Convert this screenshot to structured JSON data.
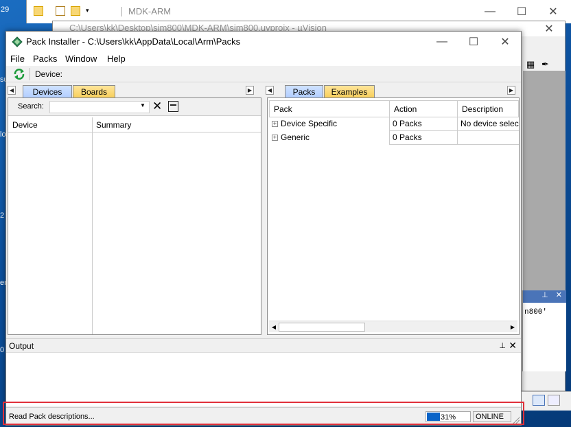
{
  "desktop": {
    "items": [
      "29",
      "su",
      "lo",
      "2",
      "er",
      "0"
    ]
  },
  "explorer": {
    "title": "MDK-ARM"
  },
  "uvision": {
    "title": "C:\\Users\\kk\\Desktop\\sim800\\MDK-ARM\\sim800.uvprojx - µVision",
    "panel_text": "n800'"
  },
  "pack_installer": {
    "title": "Pack Installer - C:\\Users\\kk\\AppData\\Local\\Arm\\Packs",
    "menu": [
      "File",
      "Packs",
      "Window",
      "Help"
    ],
    "toolbar": {
      "device_label": "Device:"
    },
    "left_tabs": [
      "Devices",
      "Boards"
    ],
    "left_active_tab": "Devices",
    "search": {
      "label": "Search:",
      "value": ""
    },
    "left_columns": [
      "Device",
      "Summary"
    ],
    "right_tabs": [
      "Packs",
      "Examples"
    ],
    "right_active_tab": "Packs",
    "right_columns": [
      "Pack",
      "Action",
      "Description"
    ],
    "pack_rows": [
      {
        "pack": "Device Specific",
        "action": "0 Packs",
        "description": "No device selected"
      },
      {
        "pack": "Generic",
        "action": "0 Packs",
        "description": ""
      }
    ],
    "output": {
      "title": "Output"
    },
    "status": {
      "message": "Read Pack descriptions...",
      "progress_percent": 31,
      "progress_label": "31%",
      "connection": "ONLINE"
    }
  },
  "colors": {
    "active_tab": "#b2ceff",
    "inactive_tab": "#f7cf5c",
    "progress": "#0a64c8",
    "highlight": "#e0303a"
  }
}
